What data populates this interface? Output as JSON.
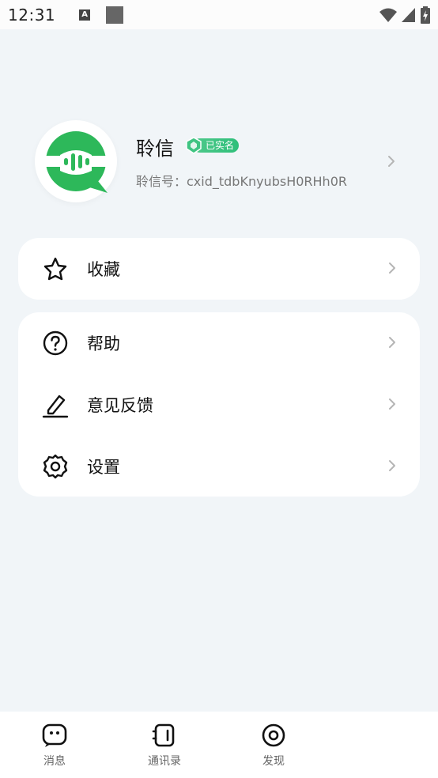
{
  "status_bar": {
    "time": "12:31",
    "a_icon_letter": "A",
    "icons": [
      "wifi-icon",
      "signal-icon",
      "battery-charging-icon"
    ]
  },
  "profile": {
    "name": "聆信",
    "verified_label": "已实名",
    "id_text": "聆信号：cxid_tdbKnyubsH0RHh0R"
  },
  "menu": {
    "favorites": {
      "label": "收藏",
      "icon": "star-icon"
    },
    "items": [
      {
        "label": "帮助",
        "icon": "help-icon"
      },
      {
        "label": "意见反馈",
        "icon": "edit-icon"
      },
      {
        "label": "设置",
        "icon": "gear-icon"
      }
    ]
  },
  "bottom_nav": {
    "items": [
      {
        "label": "消息",
        "icon": "message-icon"
      },
      {
        "label": "通讯录",
        "icon": "contacts-icon"
      },
      {
        "label": "发现",
        "icon": "discover-icon"
      }
    ]
  },
  "colors": {
    "background": "#f1f5f8",
    "brand_green": "#2db85a",
    "verified_green": "#3fc482",
    "chevron": "#b5b5b5"
  }
}
